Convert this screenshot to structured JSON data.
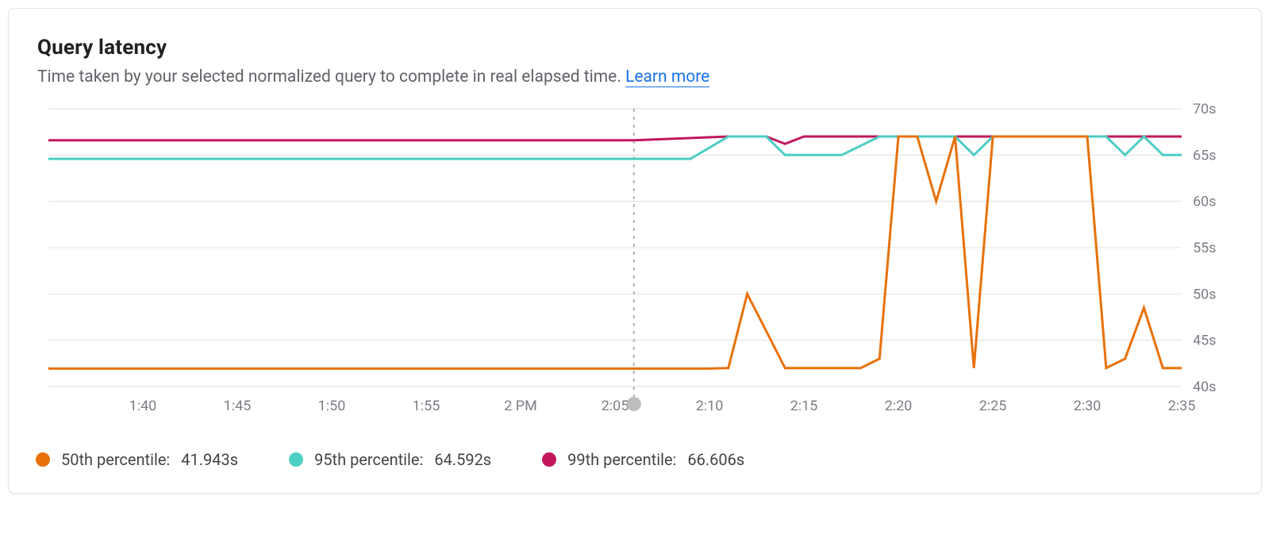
{
  "title": "Query latency",
  "subtitle_prefix": "Time taken by your selected normalized query to complete in real elapsed time. ",
  "learn_more": "Learn more",
  "legend": {
    "p50_label": "50th percentile: ",
    "p50_value": "41.943s",
    "p95_label": "95th percentile: ",
    "p95_value": "64.592s",
    "p99_label": "99th percentile: ",
    "p99_value": "66.606s"
  },
  "chart_data": {
    "type": "line",
    "title": "Query latency",
    "xlabel": "",
    "ylabel": "",
    "ylim": [
      40,
      70
    ],
    "y_ticks": [
      40,
      45,
      50,
      55,
      60,
      65,
      70
    ],
    "y_tick_labels": [
      "40s",
      "45s",
      "50s",
      "55s",
      "60s",
      "65s",
      "70s"
    ],
    "x_tick_labels": [
      "1:40",
      "1:45",
      "1:50",
      "1:55",
      "2 PM",
      "2:05",
      "2:10",
      "2:15",
      "2:20",
      "2:25",
      "2:30",
      "2:35"
    ],
    "x_index_range": [
      0,
      60
    ],
    "cursor_index": 31,
    "categories_note": "x is minute offsets from approximately 1:35 PM; ticks every 5 min",
    "series": [
      {
        "name": "50th percentile",
        "color": "#e8710a",
        "data": [
          {
            "x": 0,
            "y": 41.94
          },
          {
            "x": 5,
            "y": 41.94
          },
          {
            "x": 10,
            "y": 41.94
          },
          {
            "x": 15,
            "y": 41.94
          },
          {
            "x": 20,
            "y": 41.94
          },
          {
            "x": 25,
            "y": 41.94
          },
          {
            "x": 30,
            "y": 41.94
          },
          {
            "x": 31,
            "y": 41.94
          },
          {
            "x": 35,
            "y": 41.94
          },
          {
            "x": 36,
            "y": 42
          },
          {
            "x": 37,
            "y": 50
          },
          {
            "x": 38,
            "y": 46
          },
          {
            "x": 39,
            "y": 42
          },
          {
            "x": 40,
            "y": 42
          },
          {
            "x": 41,
            "y": 42
          },
          {
            "x": 42,
            "y": 42
          },
          {
            "x": 43,
            "y": 42
          },
          {
            "x": 44,
            "y": 43
          },
          {
            "x": 45,
            "y": 67
          },
          {
            "x": 46,
            "y": 67
          },
          {
            "x": 47,
            "y": 60
          },
          {
            "x": 48,
            "y": 67
          },
          {
            "x": 49,
            "y": 42
          },
          {
            "x": 50,
            "y": 67
          },
          {
            "x": 51,
            "y": 67
          },
          {
            "x": 52,
            "y": 67
          },
          {
            "x": 53,
            "y": 67
          },
          {
            "x": 54,
            "y": 67
          },
          {
            "x": 55,
            "y": 67
          },
          {
            "x": 56,
            "y": 42
          },
          {
            "x": 57,
            "y": 43
          },
          {
            "x": 58,
            "y": 48.5
          },
          {
            "x": 59,
            "y": 42
          },
          {
            "x": 60,
            "y": 42
          }
        ]
      },
      {
        "name": "95th percentile",
        "color": "#4ecdc4",
        "data": [
          {
            "x": 0,
            "y": 64.59
          },
          {
            "x": 5,
            "y": 64.59
          },
          {
            "x": 10,
            "y": 64.59
          },
          {
            "x": 15,
            "y": 64.59
          },
          {
            "x": 20,
            "y": 64.59
          },
          {
            "x": 25,
            "y": 64.59
          },
          {
            "x": 30,
            "y": 64.59
          },
          {
            "x": 31,
            "y": 64.59
          },
          {
            "x": 34,
            "y": 64.59
          },
          {
            "x": 36,
            "y": 67
          },
          {
            "x": 38,
            "y": 67
          },
          {
            "x": 39,
            "y": 65
          },
          {
            "x": 40,
            "y": 65
          },
          {
            "x": 41,
            "y": 65
          },
          {
            "x": 42,
            "y": 65
          },
          {
            "x": 44,
            "y": 67
          },
          {
            "x": 46,
            "y": 67
          },
          {
            "x": 48,
            "y": 67
          },
          {
            "x": 49,
            "y": 65
          },
          {
            "x": 50,
            "y": 67
          },
          {
            "x": 52,
            "y": 67
          },
          {
            "x": 54,
            "y": 67
          },
          {
            "x": 56,
            "y": 67
          },
          {
            "x": 57,
            "y": 65
          },
          {
            "x": 58,
            "y": 67
          },
          {
            "x": 59,
            "y": 65
          },
          {
            "x": 60,
            "y": 65
          }
        ]
      },
      {
        "name": "99th percentile",
        "color": "#c2185b",
        "data": [
          {
            "x": 0,
            "y": 66.6
          },
          {
            "x": 5,
            "y": 66.6
          },
          {
            "x": 10,
            "y": 66.6
          },
          {
            "x": 15,
            "y": 66.6
          },
          {
            "x": 20,
            "y": 66.6
          },
          {
            "x": 25,
            "y": 66.6
          },
          {
            "x": 30,
            "y": 66.6
          },
          {
            "x": 31,
            "y": 66.6
          },
          {
            "x": 36,
            "y": 67
          },
          {
            "x": 38,
            "y": 67
          },
          {
            "x": 39,
            "y": 66.2
          },
          {
            "x": 40,
            "y": 67
          },
          {
            "x": 45,
            "y": 67
          },
          {
            "x": 50,
            "y": 67
          },
          {
            "x": 55,
            "y": 67
          },
          {
            "x": 60,
            "y": 67
          }
        ]
      }
    ]
  }
}
